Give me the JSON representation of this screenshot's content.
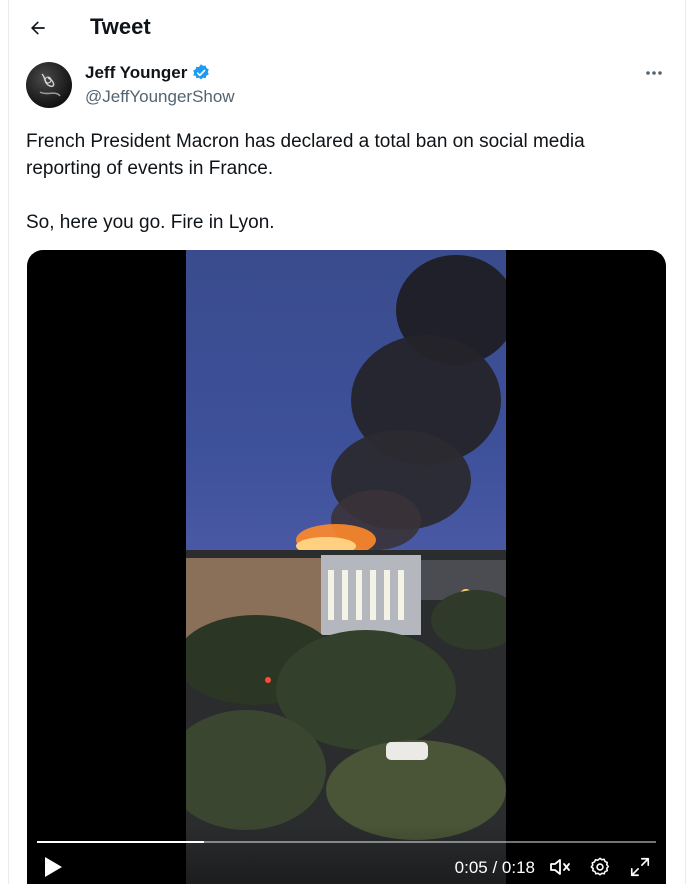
{
  "header": {
    "title": "Tweet",
    "back_icon": "arrow-left-icon"
  },
  "tweet": {
    "author": {
      "name": "Jeff Younger",
      "handle": "@JeffYoungerShow",
      "verified": true,
      "verified_color": "#1d9bf0"
    },
    "text_paragraphs": [
      "French President Macron has declared a total ban on social media reporting of events in France.",
      "So, here you go. Fire in Lyon."
    ],
    "more_icon": "more-horizontal-icon"
  },
  "video": {
    "current_time": "0:05",
    "duration": "0:18",
    "time_display": "0:05 / 0:18",
    "progress_fraction": 0.27,
    "controls": [
      "play-icon",
      "volume-muted-icon",
      "settings-gear-icon",
      "fullscreen-expand-icon"
    ]
  }
}
